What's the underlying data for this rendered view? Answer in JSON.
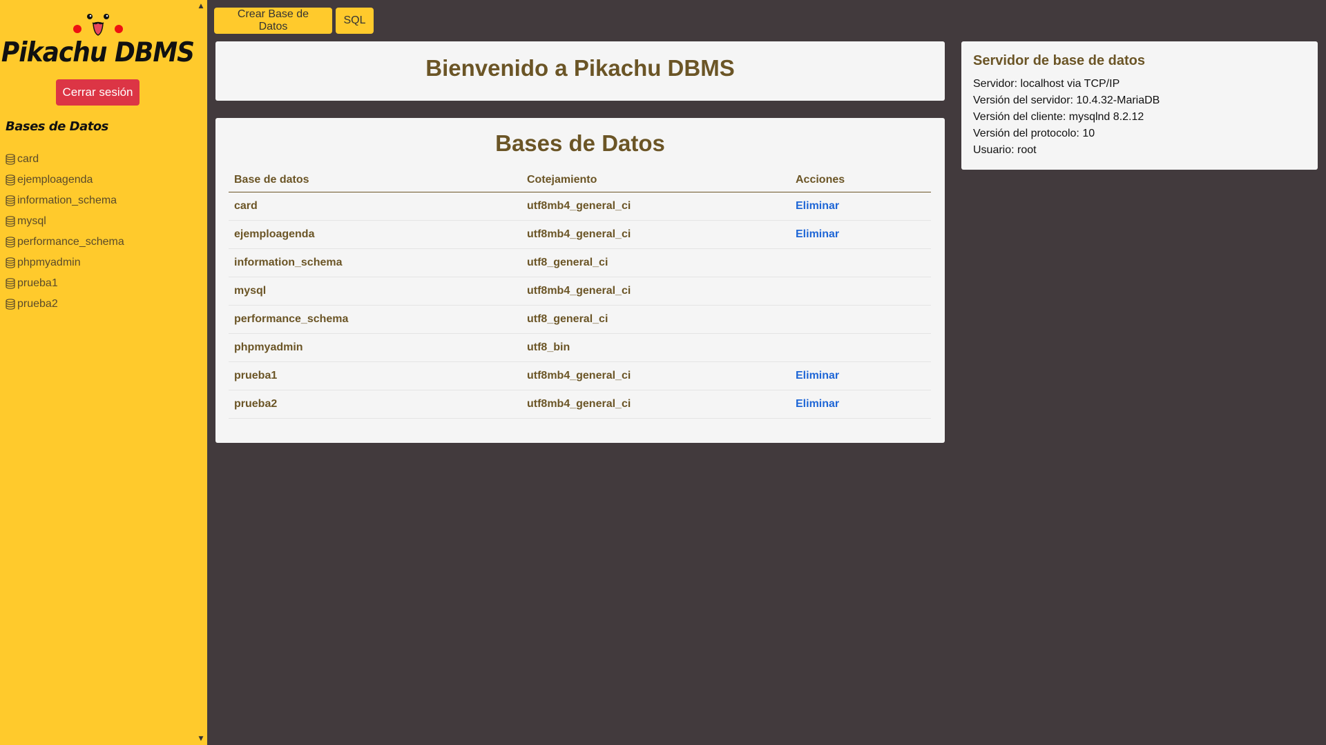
{
  "app": {
    "title": "Pikachu DBMS"
  },
  "sidebar": {
    "logout_label": "Cerrar sesión",
    "heading": "Bases de Datos",
    "databases": [
      "card",
      "ejemploagenda",
      "information_schema",
      "mysql",
      "performance_schema",
      "phpmyadmin",
      "prueba1",
      "prueba2"
    ]
  },
  "toolbar": {
    "create_label": "Crear Base de Datos",
    "sql_label": "SQL"
  },
  "welcome": {
    "title": "Bienvenido a Pikachu DBMS"
  },
  "databases_panel": {
    "title": "Bases de Datos",
    "columns": [
      "Base de datos",
      "Cotejamiento",
      "Acciones"
    ],
    "rows": [
      {
        "name": "card",
        "collation": "utf8mb4_general_ci",
        "action": "Eliminar"
      },
      {
        "name": "ejemploagenda",
        "collation": "utf8mb4_general_ci",
        "action": "Eliminar"
      },
      {
        "name": "information_schema",
        "collation": "utf8_general_ci",
        "action": ""
      },
      {
        "name": "mysql",
        "collation": "utf8mb4_general_ci",
        "action": ""
      },
      {
        "name": "performance_schema",
        "collation": "utf8_general_ci",
        "action": ""
      },
      {
        "name": "phpmyadmin",
        "collation": "utf8_bin",
        "action": ""
      },
      {
        "name": "prueba1",
        "collation": "utf8mb4_general_ci",
        "action": "Eliminar"
      },
      {
        "name": "prueba2",
        "collation": "utf8mb4_general_ci",
        "action": "Eliminar"
      }
    ]
  },
  "server": {
    "title": "Servidor de base de datos",
    "lines": [
      "Servidor: localhost via TCP/IP",
      "Versión del servidor: 10.4.32-MariaDB",
      "Versión del cliente: mysqlnd 8.2.12",
      "Versión del protocolo: 10",
      "Usuario: root"
    ]
  },
  "colors": {
    "sidebar_bg": "#ffca2c",
    "page_bg": "#423a3d",
    "card_bg": "#f5f5f5",
    "danger": "#dc3545",
    "link": "#1e66d6",
    "heading": "#6b5526"
  },
  "icons": {
    "database": "database-icon",
    "logo": "pikachu-face-icon"
  }
}
